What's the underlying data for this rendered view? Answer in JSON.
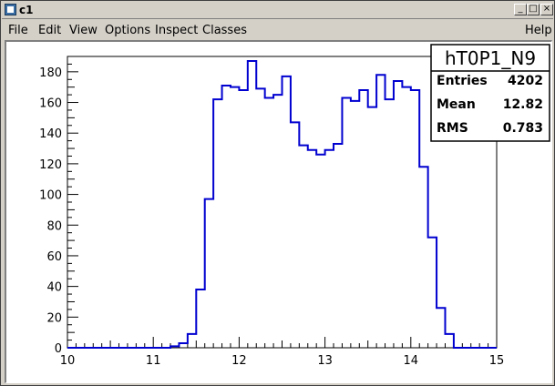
{
  "window": {
    "title": "c1",
    "minimize_glyph": "_",
    "maximize_glyph": "□",
    "close_glyph": "×",
    "icon": "root-canvas-icon"
  },
  "menu": {
    "items": [
      "File",
      "Edit",
      "View",
      "Options",
      "Inspect",
      "Classes"
    ],
    "help": "Help"
  },
  "stats": {
    "name": "hT0P1_N9",
    "entries_label": "Entries",
    "entries_value": "4202",
    "mean_label": "Mean",
    "mean_value": "12.82",
    "rms_label": "RMS",
    "rms_value": "0.783"
  },
  "chart_data": {
    "type": "bar",
    "style": "step-histogram",
    "title": "",
    "xlabel": "",
    "ylabel": "",
    "xlim": [
      10,
      15
    ],
    "ylim": [
      0,
      190
    ],
    "x_ticks": [
      10,
      11,
      12,
      13,
      14,
      15
    ],
    "y_ticks": [
      0,
      20,
      40,
      60,
      80,
      100,
      120,
      140,
      160,
      180
    ],
    "bin_width": 0.1,
    "x_start": 9.8,
    "values": [
      0,
      0,
      0,
      0,
      0,
      0,
      0,
      0,
      0,
      0,
      0,
      0,
      0,
      0,
      1,
      3,
      9,
      38,
      97,
      162,
      171,
      170,
      168,
      187,
      169,
      163,
      165,
      177,
      147,
      132,
      129,
      126,
      129,
      133,
      163,
      161,
      168,
      157,
      178,
      162,
      174,
      170,
      168,
      118,
      72,
      26,
      9,
      0,
      0,
      0,
      0,
      0
    ],
    "line_color": "#0000d0",
    "grid": false,
    "legend": "none"
  }
}
